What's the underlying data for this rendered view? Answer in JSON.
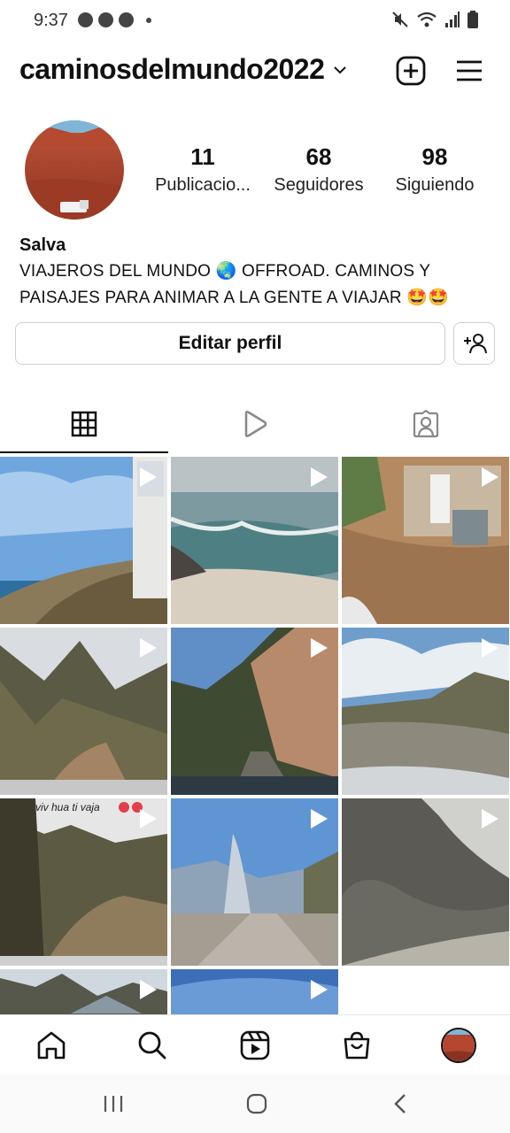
{
  "status_bar": {
    "time": "9:37"
  },
  "header": {
    "username": "caminosdelmundo2022"
  },
  "profile": {
    "stats": [
      {
        "value": "11",
        "label": "Publicacio..."
      },
      {
        "value": "68",
        "label": "Seguidores"
      },
      {
        "value": "98",
        "label": "Siguiendo"
      }
    ],
    "name": "Salva",
    "bio_line1": "VIAJEROS DEL MUNDO 🌏 OFFROAD. CAMINOS Y",
    "bio_line2": "PAISAJES PARA ANIMAR A LA GENTE A VIAJAR 🤩🤩",
    "edit_button": "Editar perfil"
  },
  "tabs": [
    "grid-tab",
    "reels-tab",
    "tagged-tab"
  ],
  "grid_overlay_text": "viv hua ti vaja",
  "colors": {
    "text": "#111111",
    "border": "#cfcfcf",
    "background": "#ffffff"
  }
}
